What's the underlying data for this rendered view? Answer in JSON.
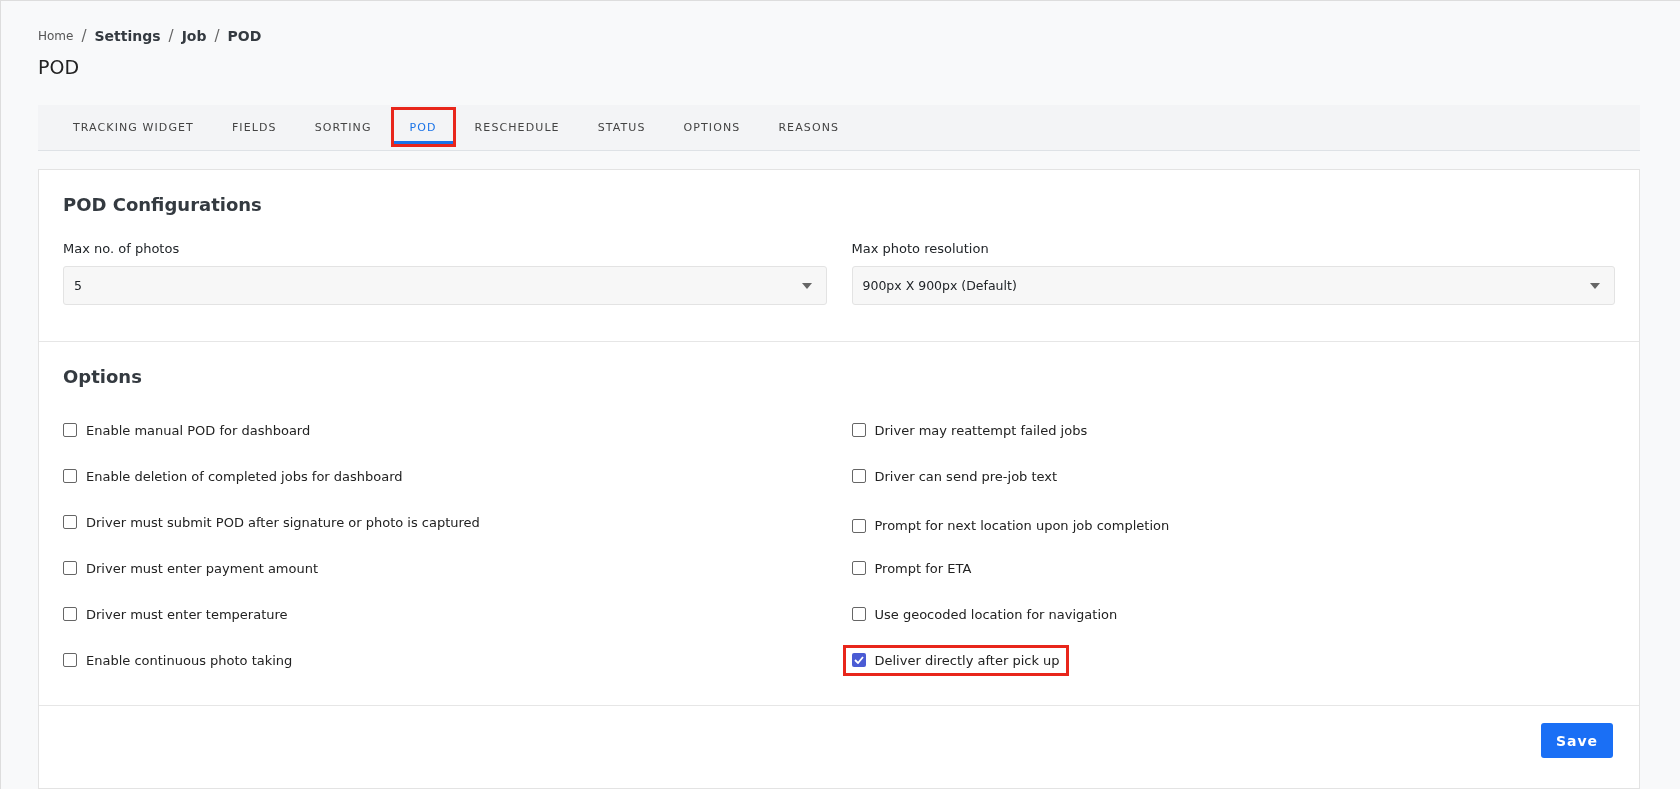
{
  "breadcrumb_separator": "/",
  "breadcrumb": [
    {
      "label": "Home",
      "kind": "link"
    },
    {
      "label": "Settings",
      "kind": "bold"
    },
    {
      "label": "Job",
      "kind": "bold"
    },
    {
      "label": "POD",
      "kind": "bold"
    }
  ],
  "page_title": "POD",
  "tabs": [
    {
      "label": "TRACKING WIDGET",
      "selected": false,
      "highlighted": false
    },
    {
      "label": "FIELDS",
      "selected": false,
      "highlighted": false
    },
    {
      "label": "SORTING",
      "selected": false,
      "highlighted": false
    },
    {
      "label": "POD",
      "selected": true,
      "highlighted": true
    },
    {
      "label": "RESCHEDULE",
      "selected": false,
      "highlighted": false
    },
    {
      "label": "STATUS",
      "selected": false,
      "highlighted": false
    },
    {
      "label": "OPTIONS",
      "selected": false,
      "highlighted": false
    },
    {
      "label": "REASONS",
      "selected": false,
      "highlighted": false
    }
  ],
  "configurations": {
    "title": "POD Configurations",
    "fields": [
      {
        "label": "Max no. of photos",
        "value": "5"
      },
      {
        "label": "Max photo resolution",
        "value": "900px X 900px (Default)"
      }
    ]
  },
  "options": {
    "title": "Options",
    "columns": [
      [
        {
          "label": "Enable manual POD for dashboard",
          "checked": false,
          "highlighted": false
        },
        {
          "label": "Enable deletion of completed jobs for dashboard",
          "checked": false,
          "highlighted": false
        },
        {
          "label": "Driver must submit POD after signature or photo is captured",
          "checked": false,
          "highlighted": false
        },
        {
          "label": "Driver must enter payment amount",
          "checked": false,
          "highlighted": false
        },
        {
          "label": "Driver must enter temperature",
          "checked": false,
          "highlighted": false
        },
        {
          "label": "Enable continuous photo taking",
          "checked": false,
          "highlighted": false
        }
      ],
      [
        {
          "label": "Driver may reattempt failed jobs",
          "checked": false,
          "highlighted": false
        },
        {
          "label": "Driver can send pre-job text",
          "checked": false,
          "highlighted": false
        },
        {
          "label": "Prompt for next location upon job completion",
          "checked": false,
          "highlighted": false
        },
        {
          "label": "Prompt for ETA",
          "checked": false,
          "highlighted": false
        },
        {
          "label": "Use geocoded location for navigation",
          "checked": false,
          "highlighted": false
        },
        {
          "label": "Deliver directly after pick up",
          "checked": true,
          "highlighted": true
        }
      ]
    ]
  },
  "save_button": "Save"
}
